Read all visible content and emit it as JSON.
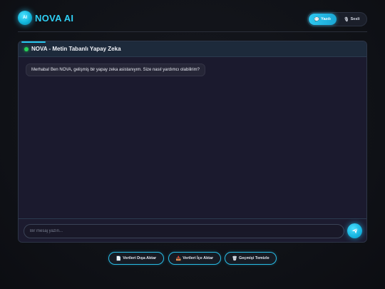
{
  "app": {
    "logo_badge": "AI",
    "title": "NOVA AI"
  },
  "mode_toggle": {
    "text_label": "Yazılı",
    "voice_label": "Sesli",
    "active": "text",
    "text_icon": "chat-icon",
    "voice_icon": "microphone-icon"
  },
  "chat": {
    "title": "NOVA - Metin Tabanlı Yapay Zeka",
    "status": "online",
    "messages": [
      {
        "sender": "assistant",
        "text": "Merhaba! Ben NOVA, gelişmiş bir yapay zeka asistanıyım. Size nasıl yardımcı olabilirim?"
      }
    ],
    "input_placeholder": "Bir mesaj yazın...",
    "input_value": "",
    "send_icon": "paper-plane-icon"
  },
  "actions": {
    "export_label": "Verileri Dışa Aktar",
    "import_label": "Verileri İçe Aktar",
    "clear_label": "Geçmişi Temizle",
    "export_icon": "document-export-icon",
    "import_icon": "document-import-icon",
    "clear_icon": "trash-icon"
  },
  "colors": {
    "accent": "#2fd0f5",
    "online": "#26d158",
    "panel": "#1b1a2e",
    "background": "#0f1116"
  }
}
